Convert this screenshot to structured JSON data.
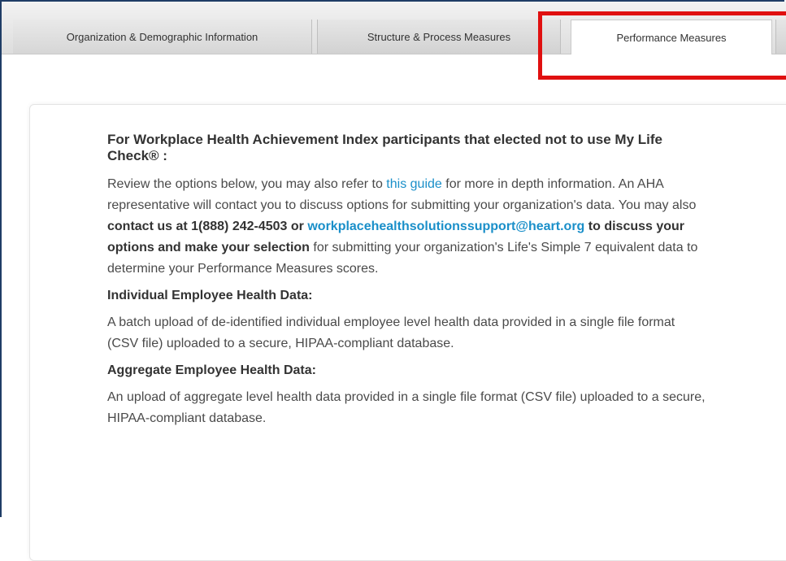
{
  "tabs": [
    {
      "label": "Organization & Demographic Information"
    },
    {
      "label": "Structure & Process Measures"
    },
    {
      "label": "Performance Measures"
    },
    {
      "label": ""
    }
  ],
  "content": {
    "heading": "For Workplace Health Achievement Index participants that elected not to use My Life Check® :",
    "intro": {
      "text1": "Review the options below, you may also refer to ",
      "guide_link": "this guide",
      "text2": " for more in depth information. An AHA representative will contact you to discuss options for submitting your organization's data. You may also ",
      "contact_bold": "contact us at 1(888) 242-4503 or ",
      "email_link": "workplacehealthsolutionssupport@heart.org",
      "bold2": " to discuss your options and make your selection",
      "text3": " for submitting your organization's Life's Simple 7 equivalent data to determine your Performance Measures scores."
    },
    "individual": {
      "title": "Individual Employee Health Data:",
      "body": "A batch upload of de-identified individual employee level health data provided in a single file format (CSV file) uploaded to a secure, HIPAA-compliant database."
    },
    "aggregate": {
      "title": "Aggregate Employee Health Data:",
      "body": "An upload of aggregate level health data provided in a single file format (CSV file) uploaded to a secure, HIPAA-compliant database."
    }
  },
  "colors": {
    "highlight": "#e01010",
    "link": "#1a8fc9",
    "frame": "#1f3d66"
  }
}
